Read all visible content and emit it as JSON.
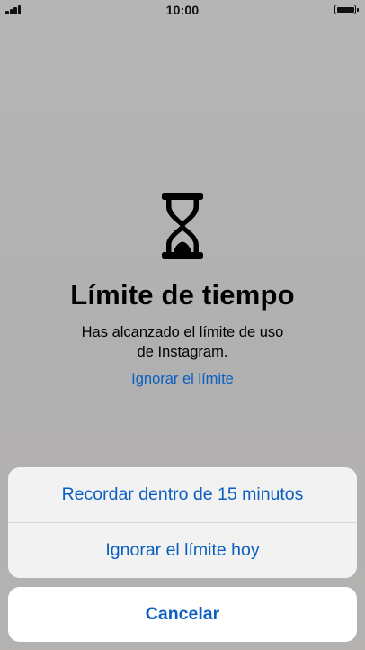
{
  "status_bar": {
    "time": "10:00",
    "signal_icon": "cellular-signal-icon",
    "battery_icon": "battery-icon"
  },
  "alert": {
    "icon": "hourglass-icon",
    "title": "Límite de tiempo",
    "message_line1": "Has alcanzado el límite de uso",
    "message_line2": "de Instagram.",
    "ignore_link": "Ignorar el límite"
  },
  "action_sheet": {
    "options": [
      "Recordar dentro de 15 minutos",
      "Ignorar el límite hoy"
    ],
    "cancel": "Cancelar"
  },
  "colors": {
    "accent": "#0b5fc0",
    "backdrop": "#b3b3b3",
    "sheet_background": "#f4f4f4"
  }
}
